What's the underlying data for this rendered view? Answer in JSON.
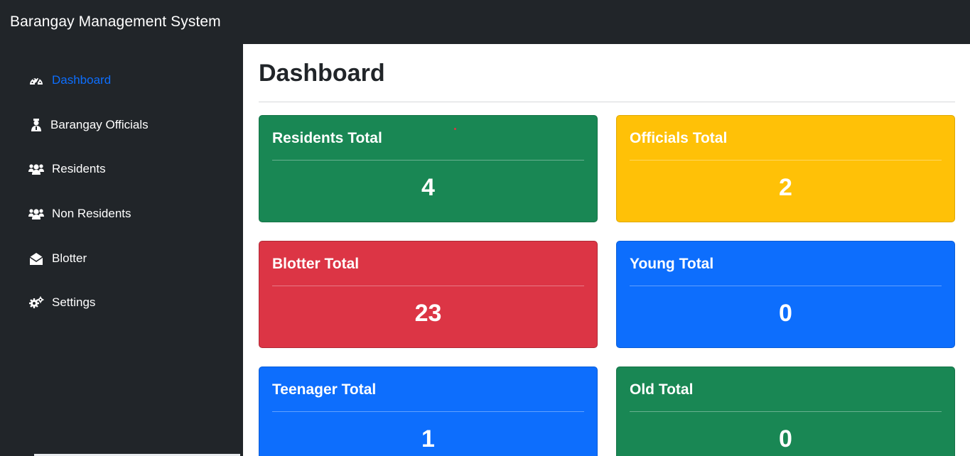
{
  "app": {
    "brand": "Barangay Management System"
  },
  "sidebar": {
    "items": [
      {
        "label": "Dashboard",
        "icon": "dashboard-gauge-icon",
        "active": true
      },
      {
        "label": "Barangay Officials",
        "icon": "official-user-icon"
      },
      {
        "label": "Residents",
        "icon": "users-icon"
      },
      {
        "label": "Non Residents",
        "icon": "users-icon"
      },
      {
        "label": "Blotter",
        "icon": "envelope-open-icon"
      },
      {
        "label": "Settings",
        "icon": "cogs-icon"
      }
    ]
  },
  "main": {
    "title": "Dashboard",
    "cards": [
      {
        "title": "Residents Total",
        "value": "4",
        "color": "#198754"
      },
      {
        "title": "Officials Total",
        "value": "2",
        "color": "#ffc107"
      },
      {
        "title": "Blotter Total",
        "value": "23",
        "color": "#dc3545"
      },
      {
        "title": "Young Total",
        "value": "0",
        "color": "#0d6efd"
      },
      {
        "title": "Teenager Total",
        "value": "1",
        "color": "#0d6efd"
      },
      {
        "title": "Old Total",
        "value": "0",
        "color": "#198754"
      }
    ]
  },
  "colors": {
    "sidebar_bg": "#212529",
    "active_link": "#0d6efd",
    "main_bg": "#ffffff"
  }
}
